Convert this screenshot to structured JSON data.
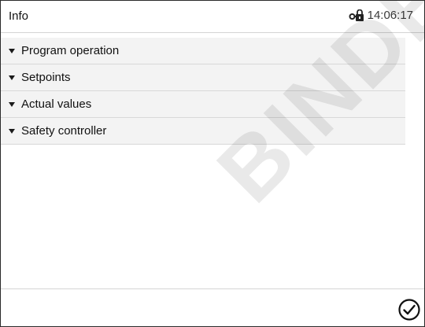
{
  "header": {
    "title": "Info",
    "time": "14:06:17",
    "status_icon": "lock-icon"
  },
  "menu": {
    "items": [
      {
        "label": "Program operation"
      },
      {
        "label": "Setpoints"
      },
      {
        "label": "Actual values"
      },
      {
        "label": "Safety controller"
      }
    ]
  },
  "watermark": {
    "text": "BINDER DEMO"
  },
  "footer": {
    "confirm_icon": "checkmark-circle-icon"
  }
}
